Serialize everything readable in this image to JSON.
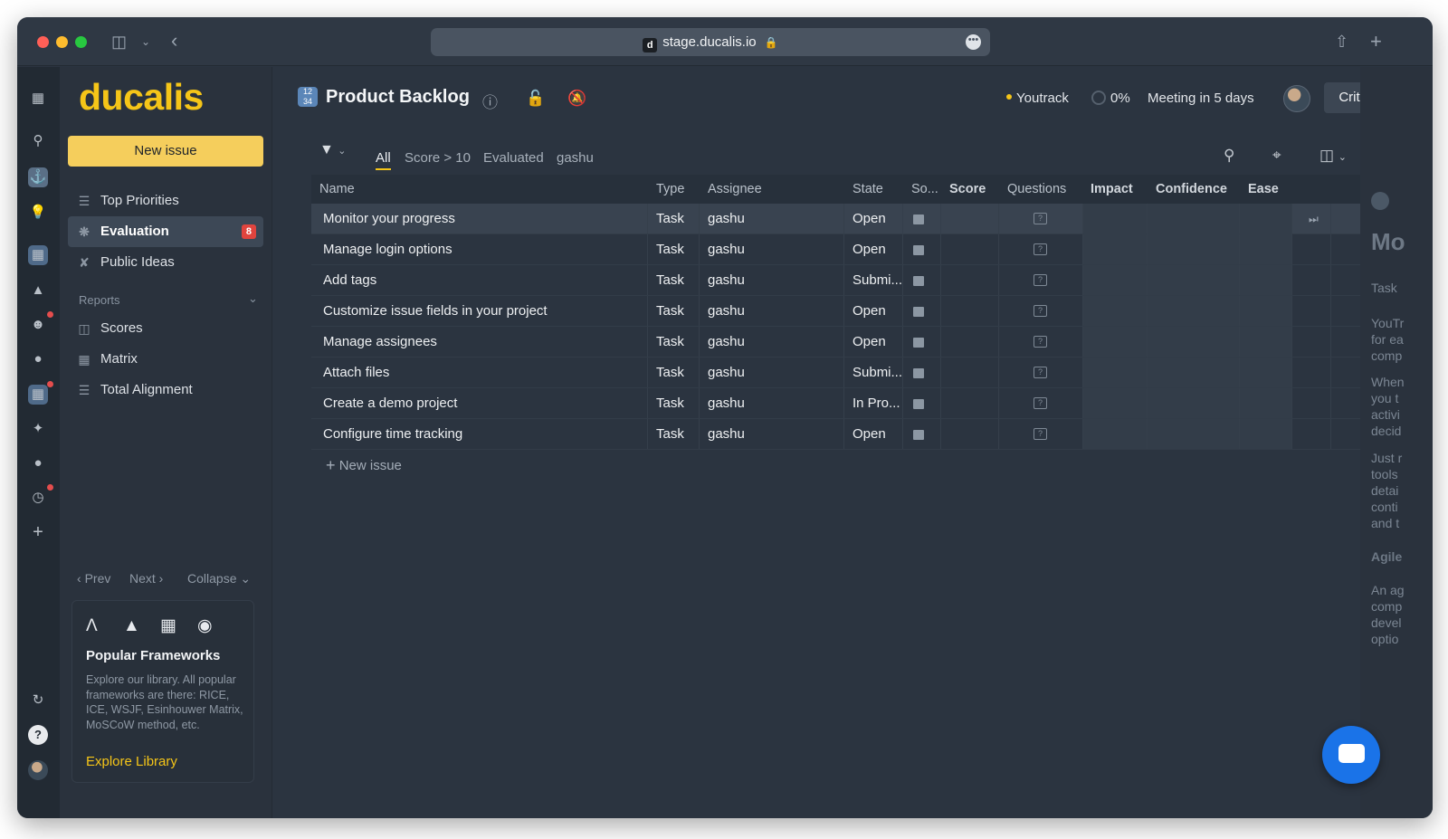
{
  "browser": {
    "url": "stage.ducalis.io",
    "favicon_letter": "d"
  },
  "sidebar": {
    "logo": "ducalis",
    "new_issue": "New issue",
    "items": [
      {
        "label": "Top Priorities",
        "icon": "list-icon"
      },
      {
        "label": "Evaluation",
        "icon": "evaluation-icon",
        "badge": "8",
        "active": true
      },
      {
        "label": "Public Ideas",
        "icon": "public-ideas-icon"
      }
    ],
    "reports_title": "Reports",
    "reports": [
      {
        "label": "Scores",
        "icon": "scores-icon"
      },
      {
        "label": "Matrix",
        "icon": "matrix-icon"
      },
      {
        "label": "Total Alignment",
        "icon": "layers-icon"
      }
    ],
    "pager": {
      "prev": "Prev",
      "next": "Next",
      "collapse": "Collapse"
    },
    "card": {
      "title": "Popular Frameworks",
      "description": "Explore our library. All popular frameworks are there: RICE, ICE, WSJF, Esinhouwer Matrix, MoSCoW method, etc.",
      "link": "Explore Library"
    }
  },
  "header": {
    "project_title": "Product Backlog",
    "integration": "Youtrack",
    "progress": "0%",
    "meeting": "Meeting in 5 days",
    "criteria_button": "Criteria"
  },
  "filters": {
    "tabs": [
      "All",
      "Score > 10",
      "Evaluated",
      "gashu"
    ],
    "active_tab": "All"
  },
  "table": {
    "columns": [
      "Name",
      "Type",
      "Assignee",
      "State",
      "So...",
      "Score",
      "Questions",
      "Impact",
      "Confidence",
      "Ease"
    ],
    "rows": [
      {
        "name": "Monitor your progress",
        "type": "Task",
        "assignee": "gashu",
        "state": "Open"
      },
      {
        "name": "Manage login options",
        "type": "Task",
        "assignee": "gashu",
        "state": "Open"
      },
      {
        "name": "Add tags",
        "type": "Task",
        "assignee": "gashu",
        "state": "Submi..."
      },
      {
        "name": "Customize issue fields in your project",
        "type": "Task",
        "assignee": "gashu",
        "state": "Open"
      },
      {
        "name": "Manage assignees",
        "type": "Task",
        "assignee": "gashu",
        "state": "Open"
      },
      {
        "name": "Attach files",
        "type": "Task",
        "assignee": "gashu",
        "state": "Submi..."
      },
      {
        "name": "Create a demo project",
        "type": "Task",
        "assignee": "gashu",
        "state": "In Pro..."
      },
      {
        "name": "Configure time tracking",
        "type": "Task",
        "assignee": "gashu",
        "state": "Open"
      }
    ],
    "add_row": "New issue"
  },
  "right_panel": {
    "lines": [
      "Mo",
      "Task",
      "YouTr",
      "for ea",
      "comp",
      "When",
      "you t",
      "activi",
      "decid",
      "Just r",
      "tools",
      "detai",
      "conti",
      "and t",
      "Agile",
      "An ag",
      "comp",
      "devel",
      "optio"
    ]
  },
  "colors": {
    "accent": "#f5c518",
    "badge": "#e0443e",
    "chat": "#1a73e8"
  }
}
